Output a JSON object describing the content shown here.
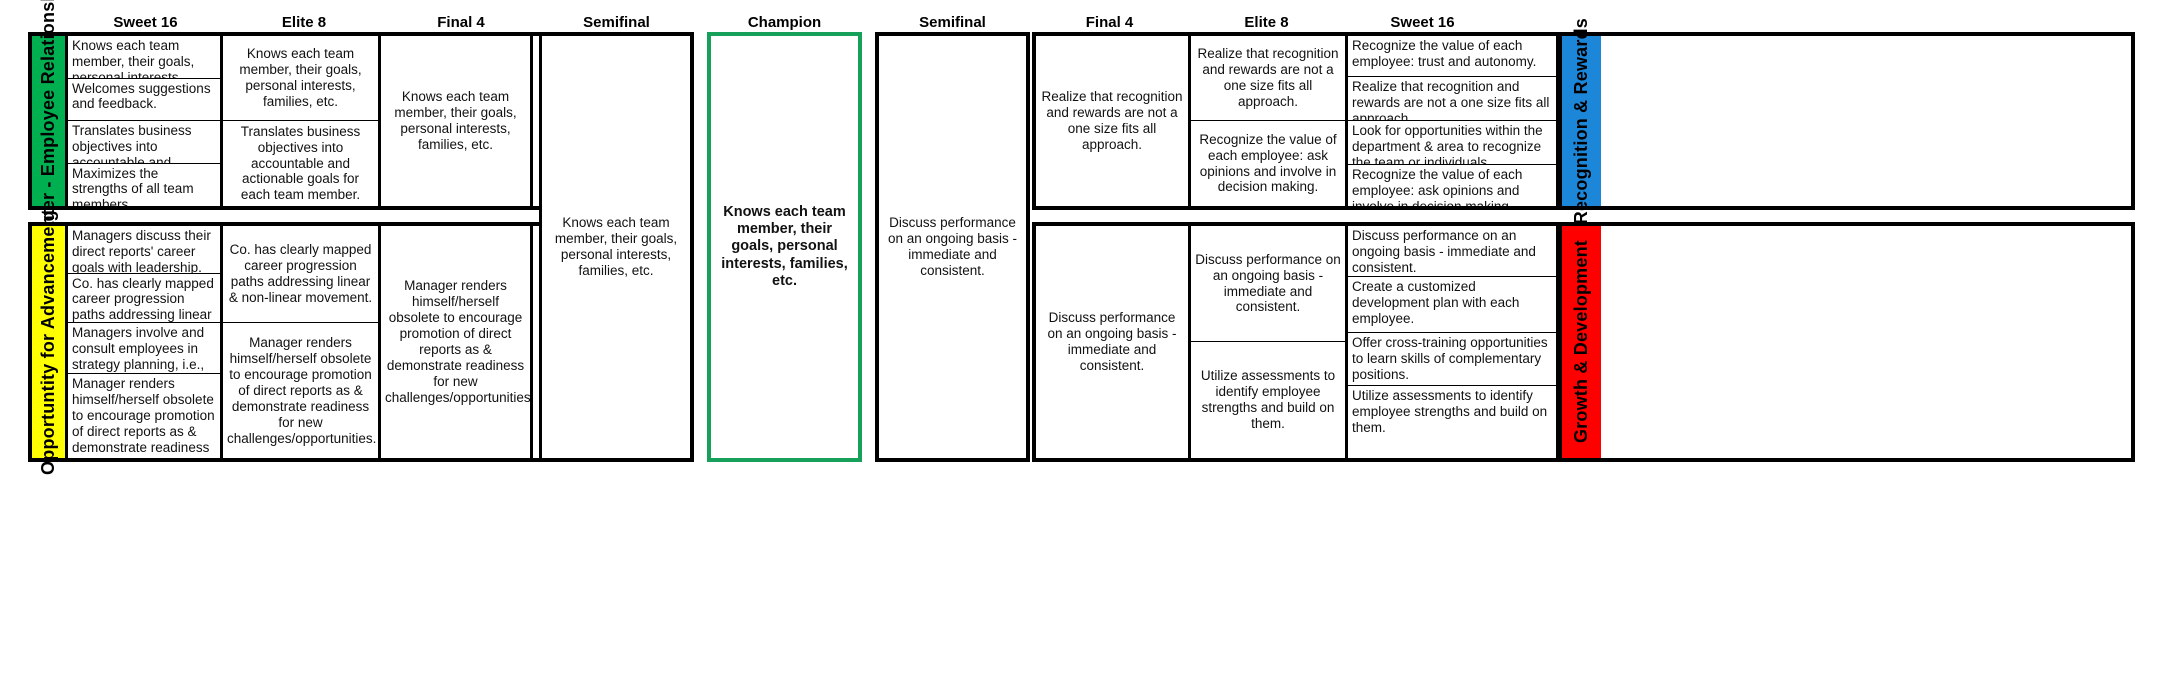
{
  "headers": {
    "left": [
      {
        "label": "Sweet 16"
      },
      {
        "label": "Elite 8"
      },
      {
        "label": "Final 4"
      },
      {
        "label": "Semifinal"
      }
    ],
    "center": {
      "label": "Champion"
    },
    "right": [
      {
        "label": "Semifinal"
      },
      {
        "label": "Final 4"
      },
      {
        "label": "Elite 8"
      },
      {
        "label": "Sweet 16"
      }
    ]
  },
  "colors": {
    "manager_employee": "#00B050",
    "opportunity": "#FFFF00",
    "recognition": "#1C86D8",
    "growth": "#FF0000",
    "champion_border": "#17a05a",
    "grid": "#000000"
  },
  "categories": {
    "top_left": "Manager - Employee Relationship",
    "bottom_left": "Opportuntity for Advancement",
    "top_right": "Recognition & Rewards",
    "bottom_right": "Growth & Development"
  },
  "top_left_bracket": {
    "sweet16": [
      "Knows each team member, their goals, personal interests, families, etc.",
      "Welcomes suggestions and feedback.",
      "Translates business objectives into accountable and actionable goals for each team member.",
      "Maximizes the strengths of all team members."
    ],
    "elite8": [
      "Knows each team member, their goals, personal interests, families, etc.",
      "Translates business objectives into accountable and actionable goals for each team member."
    ],
    "final4": [
      "Knows each team member, their goals, personal interests, families, etc."
    ]
  },
  "bottom_left_bracket": {
    "sweet16": [
      "Managers discuss their direct reports' career goals with leadership.",
      "Co. has clearly mapped career progression paths addressing linear & non-linear movement.",
      "Managers involve and consult employees in strategy planning, i.e., what should we be doing?",
      "Manager renders himself/herself obsolete to encourage promotion of direct reports as & demonstrate readiness for new challenges/opportunities."
    ],
    "elite8": [
      "Co. has clearly mapped career progression paths addressing linear & non-linear movement.",
      "Manager renders himself/herself obsolete to encourage promotion of direct reports as & demonstrate readiness for new challenges/opportunities."
    ],
    "final4": [
      "Manager renders himself/herself obsolete to encourage promotion of direct reports as & demonstrate readiness for new challenges/opportunities."
    ]
  },
  "left_semifinal": "Knows each team member, their goals, personal interests, families, etc.",
  "champion": "Knows each team member, their goals, personal interests, families, etc.",
  "right_semifinal": "Discuss performance on an ongoing basis - immediate and consistent.",
  "top_right_bracket": {
    "final4": [
      "Realize that recognition and rewards are not a one size fits all approach."
    ],
    "elite8": [
      "Realize that recognition and rewards are not a one size fits all approach.",
      "Recognize the value of each employee: ask opinions and involve in decision making."
    ],
    "sweet16": [
      "Recognize the value of each employee: trust and autonomy.",
      "Realize that recognition and rewards are not a one size fits all approach.",
      "Look for opportunities within the department & area to recognize the team or individuals.",
      "Recognize the value of each employee: ask opinions and involve in decision making."
    ]
  },
  "bottom_right_bracket": {
    "final4": [
      "Discuss performance on an ongoing basis - immediate and consistent."
    ],
    "elite8": [
      "Discuss performance on an ongoing basis - immediate and consistent.",
      "Utilize assessments to identify employee strengths and build on them."
    ],
    "sweet16": [
      "Discuss performance on an ongoing basis - immediate and consistent.",
      "Create a customized development plan with each employee.",
      "Offer cross-training opportunities to learn skills of complementary positions.",
      "Utilize assessments to identify employee strengths and build on them."
    ]
  }
}
